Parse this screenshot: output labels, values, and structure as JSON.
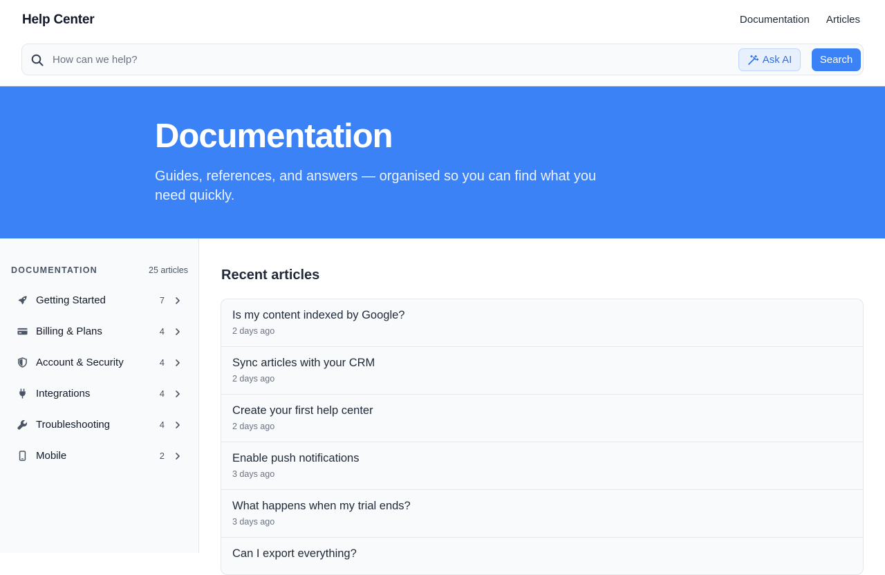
{
  "header": {
    "brand": "Help Center",
    "nav": [
      "Documentation",
      "Articles"
    ]
  },
  "search": {
    "placeholder": "How can we help?",
    "ask_ai_label": "Ask AI",
    "submit_label": "Search"
  },
  "hero": {
    "title": "Documentation",
    "subtitle": "Guides, references, and answers — organised so you can find what you need quickly."
  },
  "sidebar": {
    "title": "DOCUMENTATION",
    "count": "25 articles",
    "items": [
      {
        "label": "Getting Started",
        "count": "7",
        "icon": "rocket-icon"
      },
      {
        "label": "Billing & Plans",
        "count": "4",
        "icon": "credit-card-icon"
      },
      {
        "label": "Account & Security",
        "count": "4",
        "icon": "shield-icon"
      },
      {
        "label": "Integrations",
        "count": "4",
        "icon": "plug-icon"
      },
      {
        "label": "Troubleshooting",
        "count": "4",
        "icon": "wrench-icon"
      },
      {
        "label": "Mobile",
        "count": "2",
        "icon": "phone-icon"
      }
    ]
  },
  "main": {
    "title": "Recent articles",
    "articles": [
      {
        "title": "Is my content indexed by Google?",
        "time": "2 days ago"
      },
      {
        "title": "Sync articles with your CRM",
        "time": "2 days ago"
      },
      {
        "title": "Create your first help center",
        "time": "2 days ago"
      },
      {
        "title": "Enable push notifications",
        "time": "3 days ago"
      },
      {
        "title": "What happens when my trial ends?",
        "time": "3 days ago"
      },
      {
        "title": "Can I export everything?",
        "time": ""
      }
    ]
  },
  "colors": {
    "accent": "#3b82f6",
    "text": "#1f2937",
    "muted": "#6b7280",
    "border": "#e5e7eb",
    "panel": "#f8fafc"
  }
}
